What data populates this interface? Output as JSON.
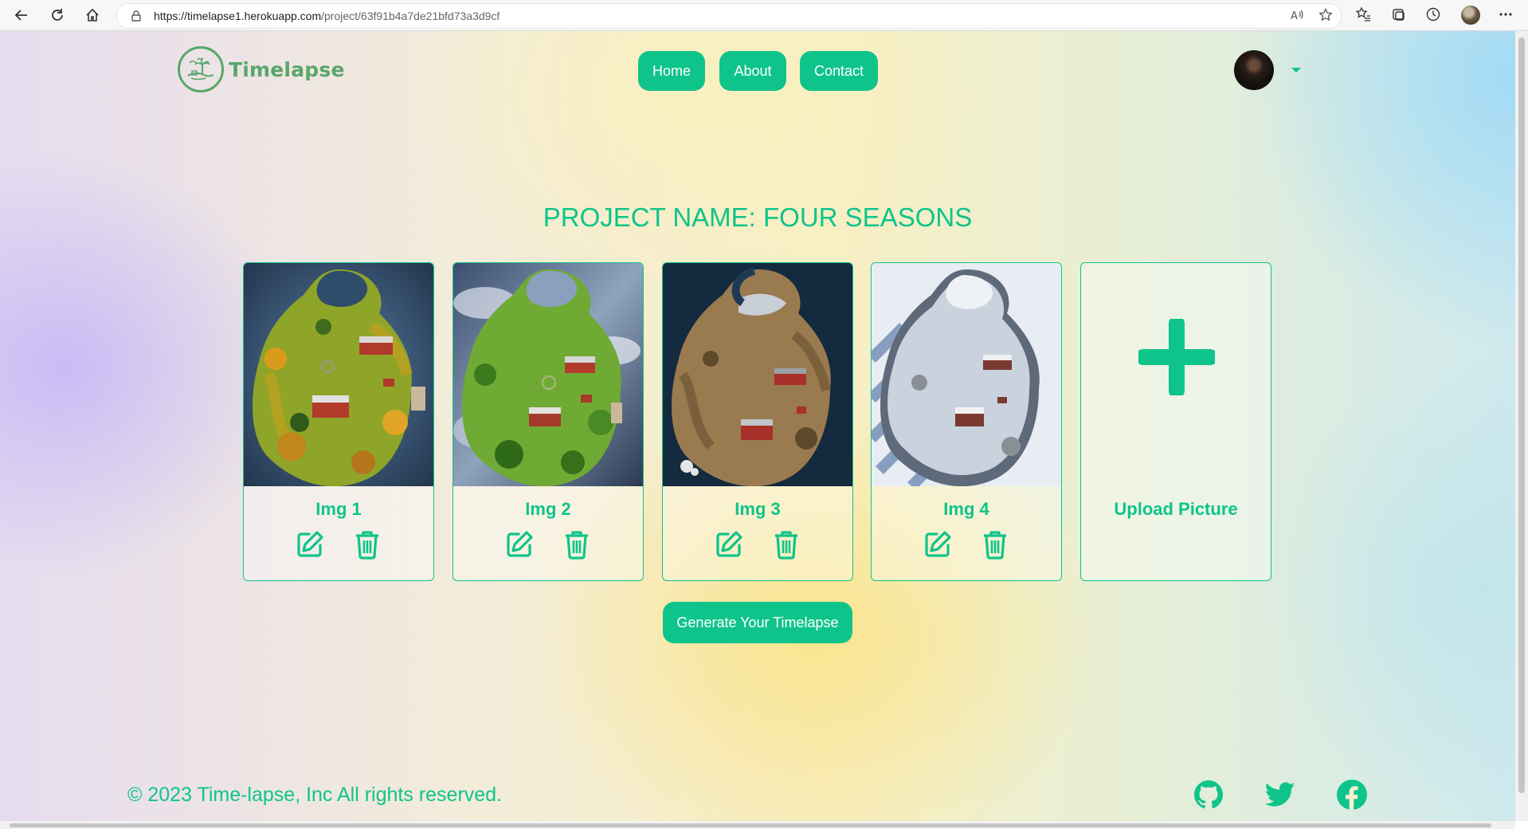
{
  "browser": {
    "url_host": "https://timelapse1.herokuapp.com",
    "url_path": "/project/63f91b4a7de21bfd73a3d9cf"
  },
  "nav": {
    "logo_text": "Timelapse",
    "links": [
      {
        "label": "Home"
      },
      {
        "label": "About"
      },
      {
        "label": "Contact"
      }
    ]
  },
  "project": {
    "title": "PROJECT NAME: FOUR SEASONS"
  },
  "images": [
    {
      "label": "Img 1",
      "season": "autumn"
    },
    {
      "label": "Img 2",
      "season": "summer"
    },
    {
      "label": "Img 3",
      "season": "spring"
    },
    {
      "label": "Img 4",
      "season": "winter"
    }
  ],
  "upload": {
    "label": "Upload Picture"
  },
  "generate_button": "Generate Your Timelapse",
  "footer": {
    "copyright": "© 2023 Time-lapse, Inc All rights reserved.",
    "social": [
      "github-icon",
      "twitter-icon",
      "facebook-icon"
    ]
  },
  "colors": {
    "accent": "#0fc48a",
    "logo": "#5aa66a"
  }
}
